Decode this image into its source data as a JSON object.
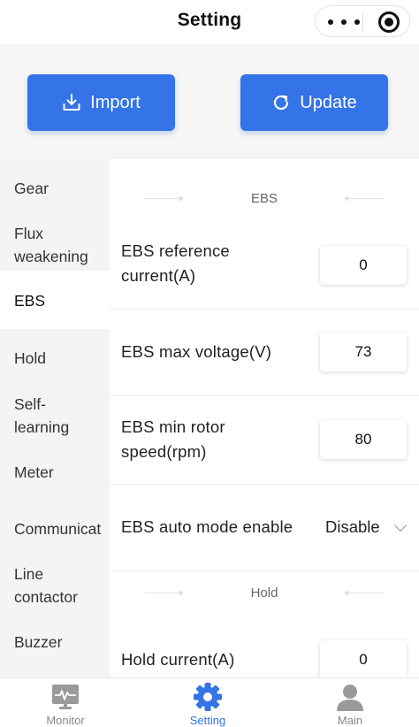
{
  "header": {
    "title": "Setting"
  },
  "actions": {
    "import_label": "Import",
    "update_label": "Update"
  },
  "sidebar": {
    "items": [
      {
        "label": "Gear"
      },
      {
        "label": "Flux\nweakening"
      },
      {
        "label": "EBS"
      },
      {
        "label": "Hold"
      },
      {
        "label": "Self-\nlearning"
      },
      {
        "label": "Meter"
      },
      {
        "label": "Communicat"
      },
      {
        "label": "Line\ncontactor"
      },
      {
        "label": "Buzzer"
      }
    ],
    "active": "EBS"
  },
  "content": {
    "sections": [
      {
        "title": "EBS"
      },
      {
        "title": "Hold"
      }
    ],
    "rows": [
      {
        "label": "EBS reference\ncurrent(A)",
        "value": "0"
      },
      {
        "label": "EBS max voltage(V)",
        "value": "73"
      },
      {
        "label": "EBS min rotor\nspeed(rpm)",
        "value": "80"
      },
      {
        "label": "EBS auto mode enable",
        "value": "Disable"
      },
      {
        "label": "Hold current(A)",
        "value": "0"
      }
    ]
  },
  "tabbar": {
    "items": [
      {
        "label": "Monitor",
        "icon": "monitor-icon"
      },
      {
        "label": "Setting",
        "icon": "gear-icon"
      },
      {
        "label": "Main",
        "icon": "user-icon"
      }
    ],
    "active": "Setting"
  },
  "colors": {
    "accent": "#3473e8",
    "sidebar_bg": "#f4f4f4",
    "inactive_icon": "#9a9a9a"
  }
}
